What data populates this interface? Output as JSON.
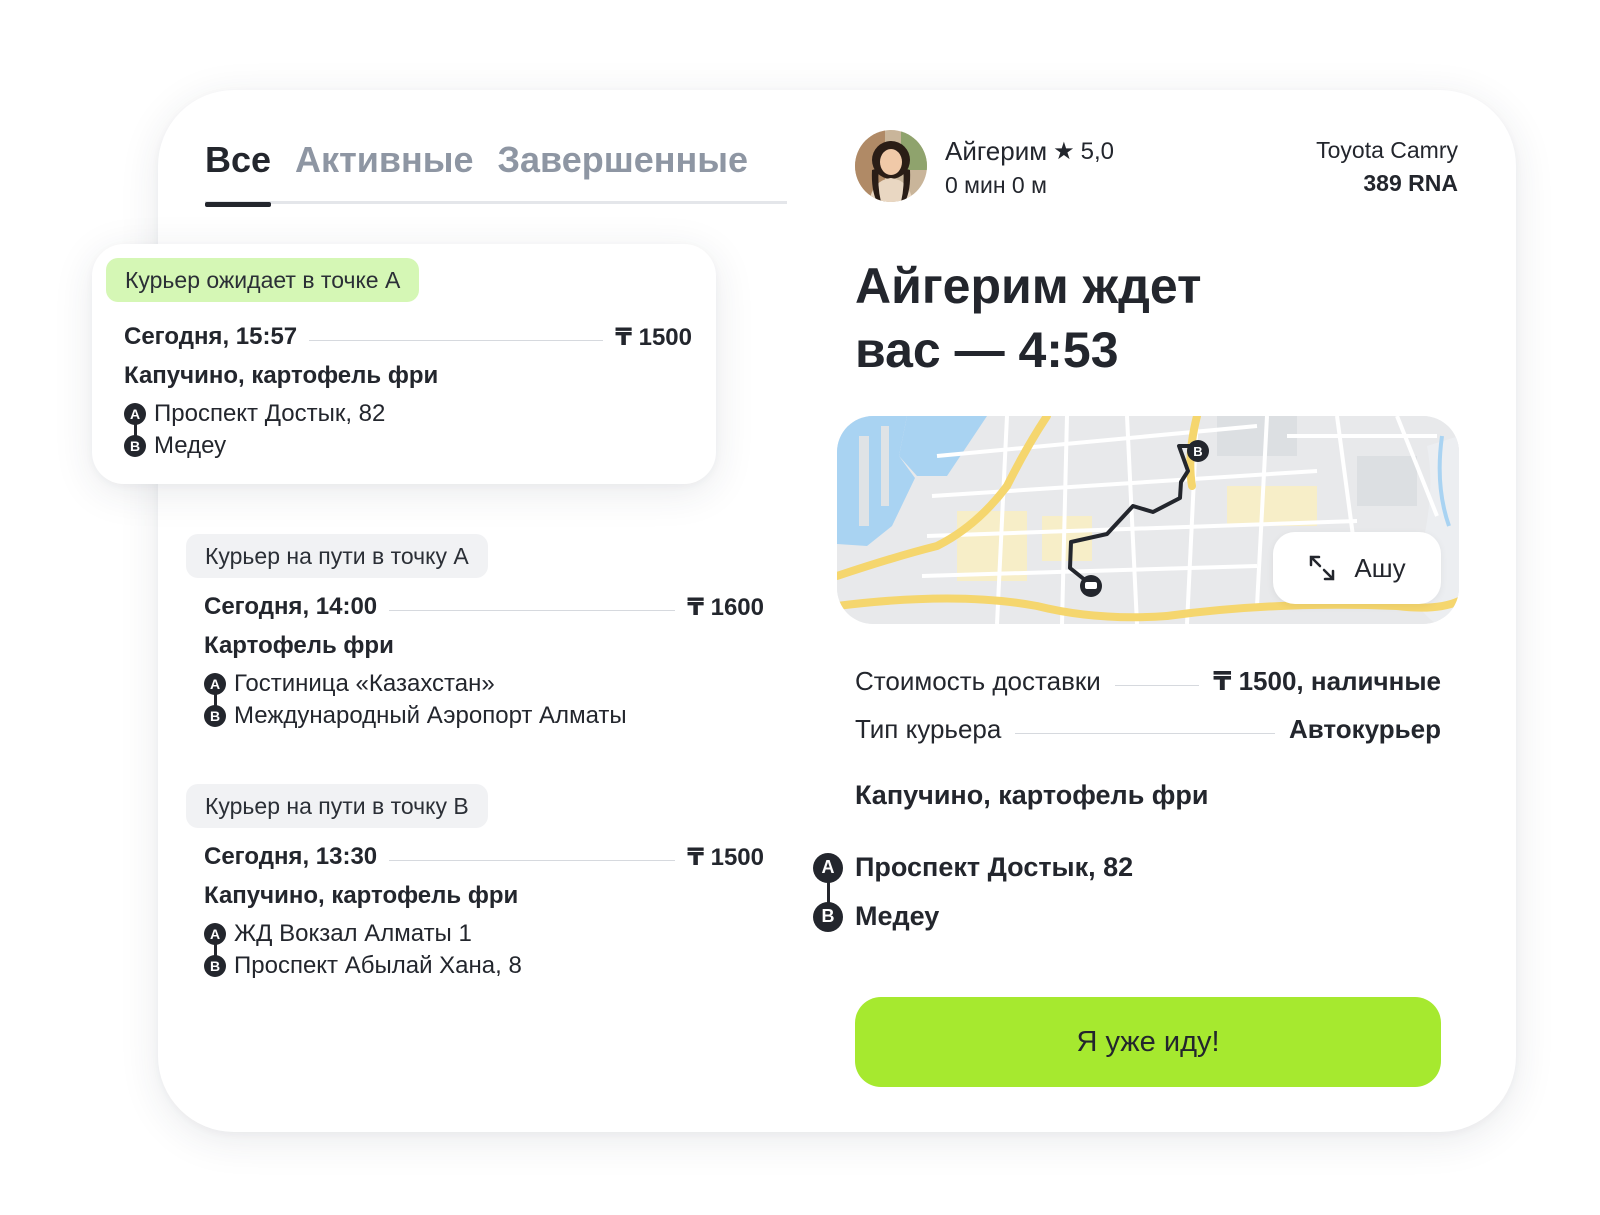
{
  "tabs": [
    {
      "label": "Все",
      "active": true
    },
    {
      "label": "Активные",
      "active": false
    },
    {
      "label": "Завершенные",
      "active": false
    }
  ],
  "orders": [
    {
      "status": "Курьер ожидает в точке А",
      "status_color": "#d5f7b5",
      "date": "Сегодня, 15:57",
      "price": "₸ 1500",
      "items": "Капучино, картофель фри",
      "point_a": "Проспект Достык, 82",
      "point_b": "Медеу"
    },
    {
      "status": "Курьер на пути в точку А",
      "status_color": "#f1f2f4",
      "date": "Сегодня, 14:00",
      "price": "₸ 1600",
      "items": "Картофель фри",
      "point_a": "Гостиница «Казахстан»",
      "point_b": "Международный Аэропорт Алматы"
    },
    {
      "status": "Курьер на пути в точку В",
      "status_color": "#f1f2f4",
      "date": "Сегодня, 13:30",
      "price": "₸ 1500",
      "items": "Капучино, картофель фри",
      "point_a": "ЖД Вокзал Алматы 1",
      "point_b": "Проспект Абылай Хана, 8"
    }
  ],
  "pin_labels": {
    "a": "A",
    "b": "B"
  },
  "courier": {
    "name": "Айгерим",
    "rating": "5,0",
    "eta": "0 мин 0 м",
    "car_model": "Toyota Camry",
    "car_plate": "389 RNA"
  },
  "headline": {
    "line1": "Айгерим ждет",
    "line2": "вас — 4:53"
  },
  "map": {
    "expand_label": "Ашу"
  },
  "details": {
    "cost_label": "Стоимость доставки",
    "cost_value": "₸ 1500, наличные",
    "type_label": "Тип курьера",
    "type_value": "Автокурьер",
    "items": "Капучино, картофель фри",
    "point_a": "Проспект Достык, 82",
    "point_b": "Медеу"
  },
  "cta_label": "Я уже иду!",
  "colors": {
    "accent": "#a6e92f",
    "status_green": "#d5f7b5",
    "status_grey": "#f1f2f4",
    "text": "#23262d",
    "inactive_tab": "#8e96a3"
  }
}
